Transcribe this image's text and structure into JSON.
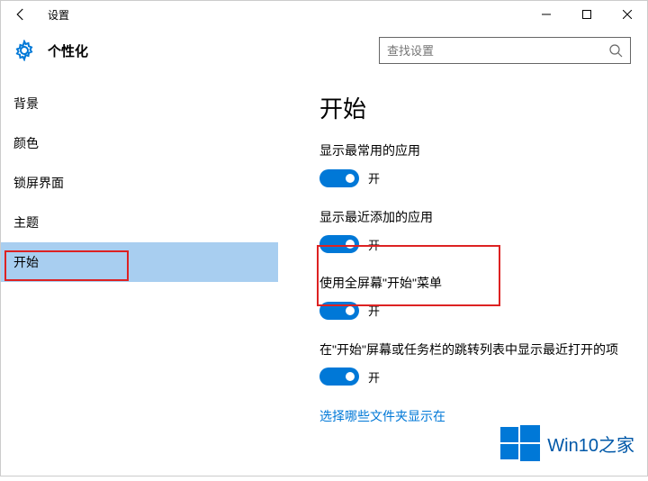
{
  "titlebar": {
    "title": "设置"
  },
  "header": {
    "page_title": "个性化",
    "search_placeholder": "查找设置"
  },
  "sidebar": {
    "items": [
      {
        "label": "背景"
      },
      {
        "label": "颜色"
      },
      {
        "label": "锁屏界面"
      },
      {
        "label": "主题"
      },
      {
        "label": "开始"
      }
    ]
  },
  "main": {
    "heading": "开始",
    "settings": [
      {
        "label": "显示最常用的应用",
        "state": "开"
      },
      {
        "label": "显示最近添加的应用",
        "state": "开"
      },
      {
        "label": "使用全屏幕\"开始\"菜单",
        "state": "开"
      },
      {
        "label": "在\"开始\"屏幕或任务栏的跳转列表中显示最近打开的项",
        "state": "开"
      }
    ],
    "link": "选择哪些文件夹显示在"
  },
  "watermark": {
    "text": "Win10之家"
  },
  "colors": {
    "accent": "#0078d7",
    "highlight": "#d22",
    "sidebar_selected": "#a8cef0"
  }
}
